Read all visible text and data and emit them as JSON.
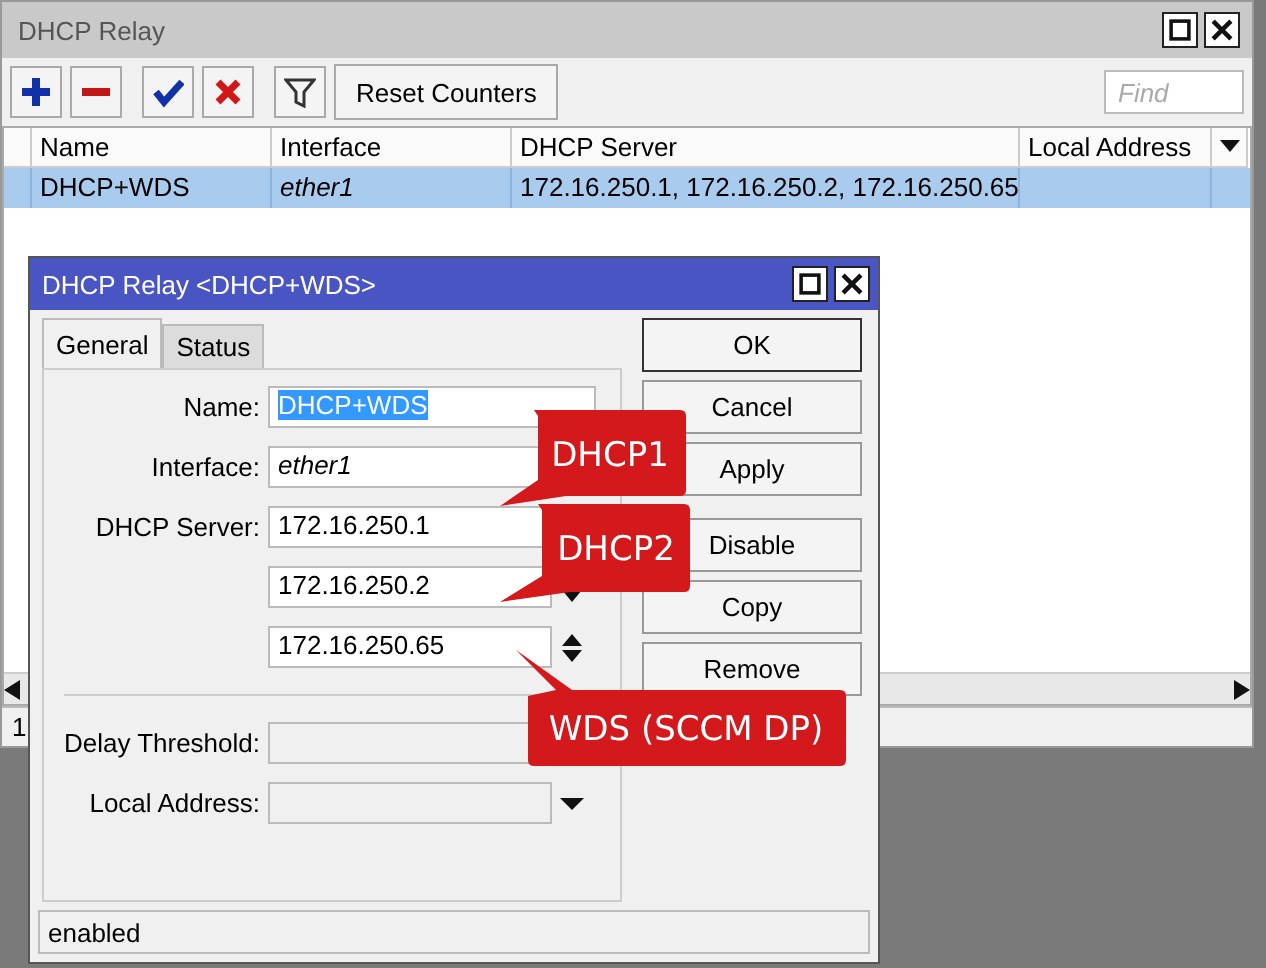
{
  "window": {
    "title": "DHCP Relay"
  },
  "toolbar": {
    "reset_button": "Reset Counters",
    "find": {
      "placeholder": "Find"
    }
  },
  "table": {
    "columns": [
      "Name",
      "Interface",
      "DHCP Server",
      "Local Address"
    ],
    "rows": [
      {
        "selected": true,
        "cells": [
          "DHCP+WDS",
          "ether1",
          "172.16.250.1, 172.16.250.2, 172.16.250.65",
          ""
        ]
      }
    ]
  },
  "status_bar": "1",
  "dialog": {
    "title": "DHCP Relay <DHCP+WDS>",
    "tabs": [
      {
        "label": "General",
        "selected": true
      },
      {
        "label": "Status",
        "selected": false
      }
    ],
    "name": {
      "label": "Name:",
      "value": "DHCP+WDS",
      "selected": true
    },
    "interface": {
      "label": "Interface:",
      "value": "ether1"
    },
    "dhcp_server": {
      "label": "DHCP Server:",
      "values": [
        "172.16.250.1",
        "172.16.250.2",
        "172.16.250.65"
      ]
    },
    "delay_threshold": {
      "label": "Delay Threshold:"
    },
    "local_address": {
      "label": "Local Address:"
    },
    "buttons": [
      "OK",
      "Cancel",
      "Apply",
      "Disable",
      "Copy",
      "Remove"
    ],
    "status": "enabled"
  },
  "callouts": [
    {
      "text": "DHCP1"
    },
    {
      "text": "DHCP2"
    },
    {
      "text": "WDS (SCCM DP)"
    }
  ]
}
